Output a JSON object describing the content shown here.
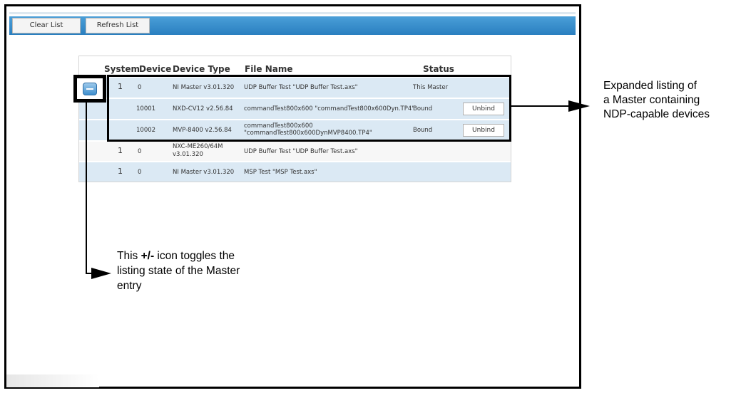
{
  "toolbar": {
    "clear_label": "Clear List",
    "refresh_label": "Refresh List"
  },
  "table": {
    "headers": {
      "system": "System",
      "device": "Device",
      "device_type": "Device Type",
      "file_name": "File Name",
      "status": "Status"
    },
    "rows": [
      {
        "system": "1",
        "device": "0",
        "device_type": "NI Master v3.01.320",
        "file_name": "UDP Buffer Test \"UDP Buffer Test.axs\"",
        "status": "This Master",
        "action": ""
      },
      {
        "system": "",
        "device": "10001",
        "device_type": "NXD-CV12 v2.56.84",
        "file_name": "commandTest800x600 \"commandTest800x600Dyn.TP4\"",
        "status": "Bound",
        "action": "Unbind"
      },
      {
        "system": "",
        "device": "10002",
        "device_type": "MVP-8400 v2.56.84",
        "file_name_line1": "commandTest800x600",
        "file_name_line2": "\"commandTest800x600DynMVP8400.TP4\"",
        "status": "Bound",
        "action": "Unbind"
      },
      {
        "system": "1",
        "device": "0",
        "device_type_line1": "NXC-ME260/64M",
        "device_type_line2": "v3.01.320",
        "file_name": "UDP Buffer Test \"UDP Buffer Test.axs\"",
        "status": "",
        "action": ""
      },
      {
        "system": "1",
        "device": "0",
        "device_type": "NI Master v3.01.320",
        "file_name": "MSP Test \"MSP Test.axs\"",
        "status": "",
        "action": ""
      }
    ]
  },
  "annotations": {
    "right": [
      "Expanded listing of",
      "a Master containing",
      "NDP-capable devices"
    ],
    "bottom": {
      "line1_pre": "This ",
      "line1_bold": "+/-",
      "line1_post": " icon toggles the",
      "line2": "listing state of the Master",
      "line3": "entry"
    }
  },
  "icons": {
    "toggle": "minus-toggle-icon"
  },
  "colors": {
    "toolbar": "#2a7fc0",
    "row_blue": "#dbe9f4",
    "row_white": "#f7f7f7"
  }
}
